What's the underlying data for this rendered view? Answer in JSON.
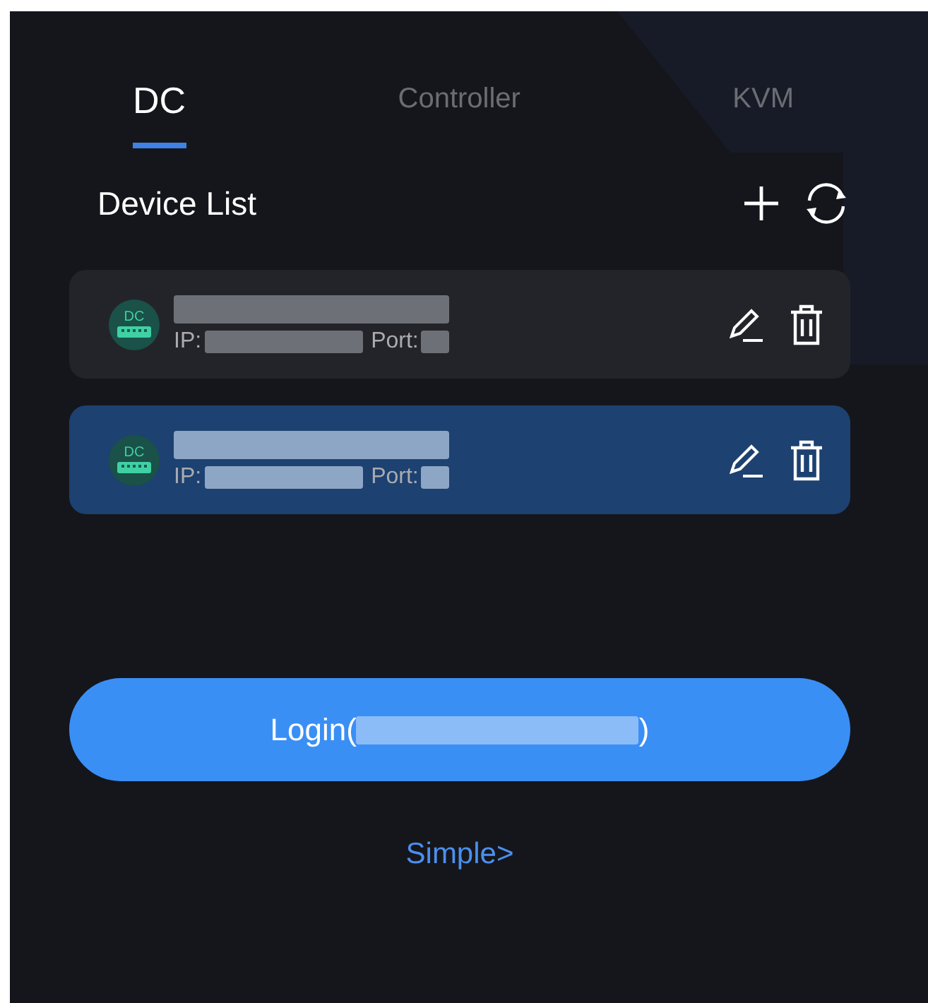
{
  "tabs": [
    {
      "label": "DC",
      "selected": true
    },
    {
      "label": "Controller",
      "selected": false
    },
    {
      "label": "KVM",
      "selected": false
    }
  ],
  "device_list": {
    "title": "Device List",
    "devices": [
      {
        "badge": "DC",
        "ip_label": "IP:",
        "port_label": "Port:",
        "selected": false
      },
      {
        "badge": "DC",
        "ip_label": "IP:",
        "port_label": "Port:",
        "selected": true
      }
    ]
  },
  "login_button": {
    "prefix": "Login(",
    "suffix": ")"
  },
  "simple_link": "Simple>"
}
